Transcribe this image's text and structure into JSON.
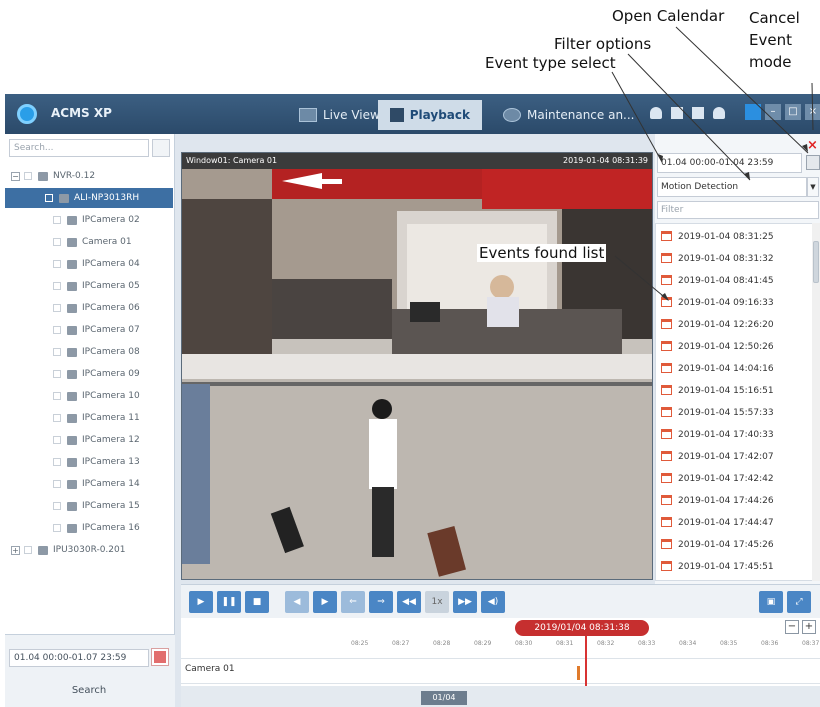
{
  "annotations": {
    "open_calendar": "Open Calendar",
    "cancel_event_mode": "Cancel\nEvent\nmode",
    "filter_options": "Filter options",
    "event_type_select": "Event type select",
    "events_found_list": "Events found list"
  },
  "app": {
    "title": "ACMS XP",
    "tabs": [
      {
        "label": "Live View",
        "active": false
      },
      {
        "label": "Playback",
        "active": true
      },
      {
        "label": "Maintenance an...",
        "active": false
      }
    ]
  },
  "left_panel": {
    "search_placeholder": "Search...",
    "tree": [
      {
        "label": "NVR-0.12",
        "level": 0,
        "expand": "−"
      },
      {
        "label": "ALI-NP3013RH",
        "level": 1,
        "selected": true
      },
      {
        "label": "IPCamera 02",
        "level": 2
      },
      {
        "label": "Camera 01",
        "level": 2
      },
      {
        "label": "IPCamera 04",
        "level": 2
      },
      {
        "label": "IPCamera 05",
        "level": 2
      },
      {
        "label": "IPCamera 06",
        "level": 2
      },
      {
        "label": "IPCamera 07",
        "level": 2
      },
      {
        "label": "IPCamera 08",
        "level": 2
      },
      {
        "label": "IPCamera 09",
        "level": 2
      },
      {
        "label": "IPCamera 10",
        "level": 2
      },
      {
        "label": "IPCamera 11",
        "level": 2
      },
      {
        "label": "IPCamera 12",
        "level": 2
      },
      {
        "label": "IPCamera 13",
        "level": 2
      },
      {
        "label": "IPCamera 14",
        "level": 2
      },
      {
        "label": "IPCamera 15",
        "level": 2
      },
      {
        "label": "IPCamera 16",
        "level": 2
      },
      {
        "label": "IPU3030R-0.201",
        "level": 0,
        "expand": "+"
      }
    ],
    "date_range": "01.04 00:00-01.07 23:59",
    "search_button": "Search"
  },
  "video": {
    "window_label": "Window01: Camera 01",
    "timestamp": "2019-01-04 08:31:39"
  },
  "right_panel": {
    "date_range": "01.04 00:00-01.04 23:59",
    "cancel_icon": "×",
    "event_type": "Motion Detection",
    "filter_placeholder": "Filter",
    "events": [
      "2019-01-04 08:31:25",
      "2019-01-04 08:31:32",
      "2019-01-04 08:41:45",
      "2019-01-04 09:16:33",
      "2019-01-04 12:26:20",
      "2019-01-04 12:50:26",
      "2019-01-04 14:04:16",
      "2019-01-04 15:16:51",
      "2019-01-04 15:57:33",
      "2019-01-04 17:40:33",
      "2019-01-04 17:42:07",
      "2019-01-04 17:42:42",
      "2019-01-04 17:44:26",
      "2019-01-04 17:44:47",
      "2019-01-04 17:45:26",
      "2019-01-04 17:45:51"
    ]
  },
  "controls": {
    "speed": "1x"
  },
  "timeline": {
    "current_time": "2019/01/04 08:31:38",
    "ticks": [
      "08:25",
      "08:27",
      "08:28",
      "08:29",
      "08:30",
      "08:31",
      "08:32",
      "08:33",
      "08:34",
      "08:35",
      "08:36",
      "08:37"
    ],
    "camera_label": "Camera 01",
    "page_indicator": "01/04",
    "zoom_out": "−",
    "zoom_in": "+"
  }
}
